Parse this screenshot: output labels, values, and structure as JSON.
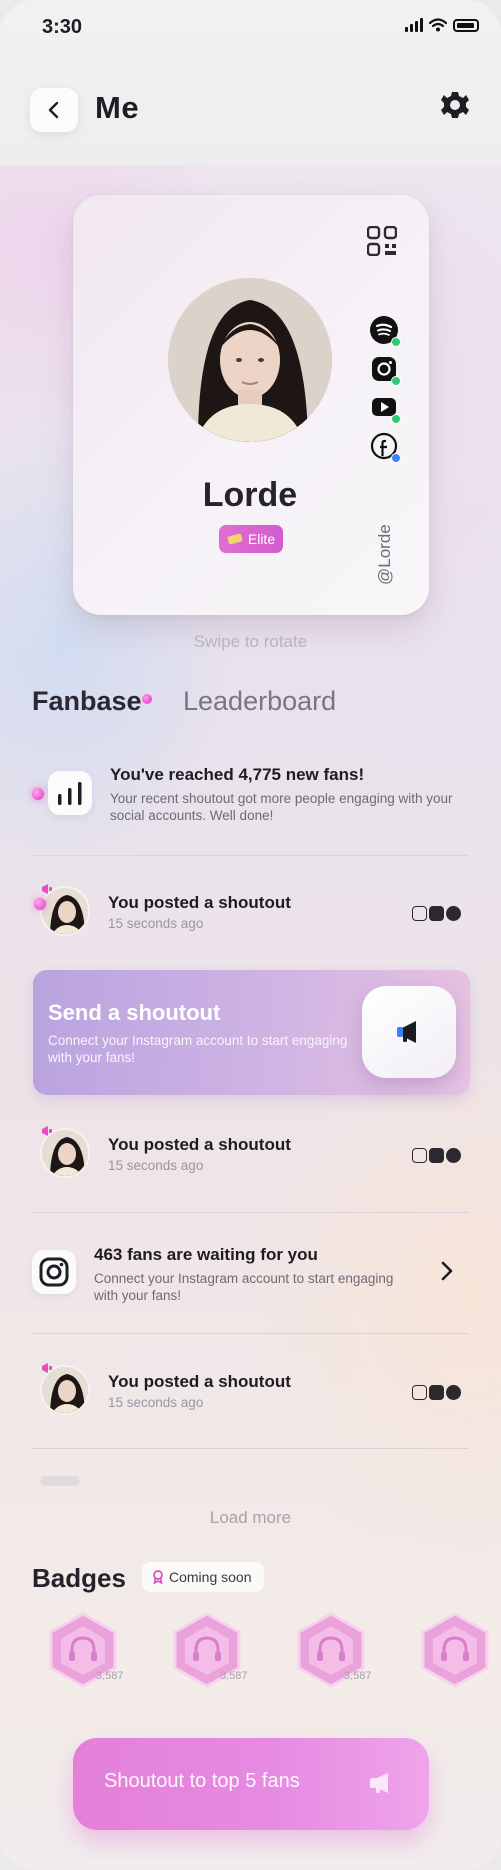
{
  "status_bar": {
    "time": "3:30"
  },
  "header": {
    "title": "Me"
  },
  "profile_card": {
    "name": "Lorde",
    "tier_badge": "Elite",
    "handle": "@Lorde",
    "connected_accounts": [
      "spotify-icon",
      "instagram-icon",
      "youtube-icon",
      "facebook-icon"
    ]
  },
  "swipe_hint": "Swipe to rotate",
  "tabs": {
    "active": "Fanbase",
    "inactive": "Leaderboard"
  },
  "feed": {
    "fans_reached": {
      "title": "You've reached 4,775 new fans!",
      "subtitle": "Your recent shoutout got more people engaging with your social accounts. Well done!"
    },
    "posts": [
      {
        "title": "You posted a shoutout",
        "time": "15 seconds ago"
      },
      {
        "title": "You posted a shoutout",
        "time": "15 seconds ago"
      },
      {
        "title": "You posted a shoutout",
        "time": "15 seconds ago"
      }
    ],
    "send_shoutout": {
      "title": "Send a shoutout",
      "subtitle": "Connect your Instagram account to start engaging with your fans!"
    },
    "fans_waiting": {
      "title": "463 fans are waiting for you",
      "subtitle": "Connect your Instagram account to start engaging with your fans!"
    },
    "load_more": "Load more"
  },
  "badges": {
    "title": "Badges",
    "coming_soon": "Coming soon",
    "items": [
      {
        "count": "3,587"
      },
      {
        "count": "3,587"
      },
      {
        "count": "3,587"
      },
      {
        "count": ""
      }
    ]
  },
  "cta": {
    "label": "Shoutout to top 5 fans"
  },
  "colors": {
    "accent_pink": "#e06ed2",
    "shoutout_gradient_start": "#b9a3e0",
    "shoutout_gradient_end": "#e7c2e2",
    "connected_green": "#2ecc71"
  }
}
